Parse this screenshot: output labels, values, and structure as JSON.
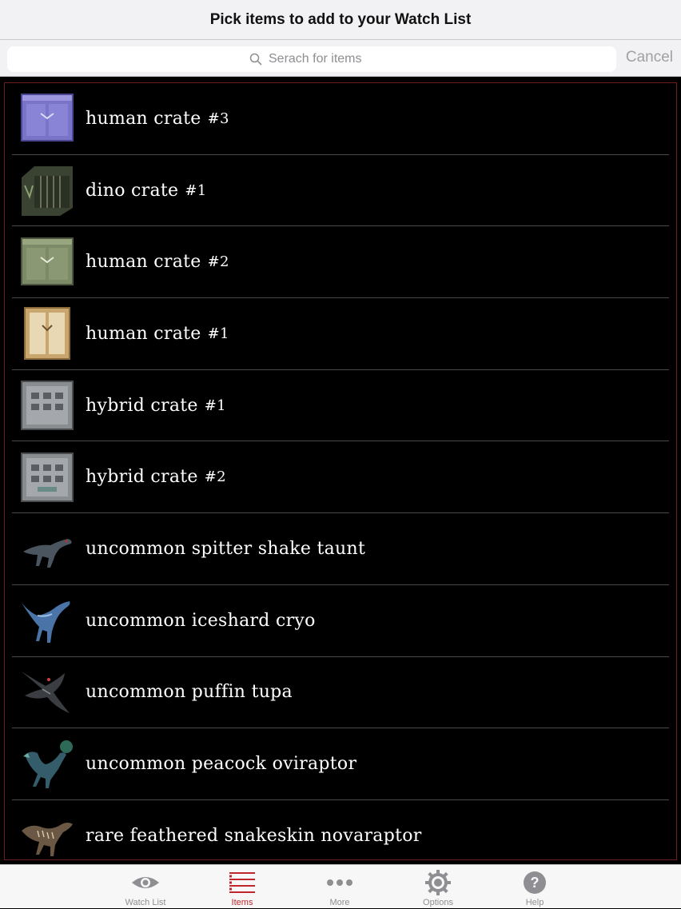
{
  "header": {
    "title": "Pick items to add to your Watch List"
  },
  "search": {
    "placeholder": "Serach for items",
    "cancel_label": "Cancel"
  },
  "items": [
    {
      "name": "human crate",
      "suffix": "#3",
      "icon": "crate-icon"
    },
    {
      "name": "dino crate",
      "suffix": "#1",
      "icon": "crate-icon"
    },
    {
      "name": "human crate",
      "suffix": "#2",
      "icon": "crate-icon"
    },
    {
      "name": "human crate",
      "suffix": "#1",
      "icon": "crate-icon"
    },
    {
      "name": "hybrid crate",
      "suffix": "#1",
      "icon": "crate-icon"
    },
    {
      "name": "hybrid crate",
      "suffix": "#2",
      "icon": "crate-icon"
    },
    {
      "name": "uncommon spitter shake taunt",
      "suffix": "",
      "icon": "dinosaur-icon"
    },
    {
      "name": "uncommon iceshard cryo",
      "suffix": "",
      "icon": "dinosaur-icon"
    },
    {
      "name": "uncommon puffin tupa",
      "suffix": "",
      "icon": "dinosaur-icon"
    },
    {
      "name": "uncommon peacock oviraptor",
      "suffix": "",
      "icon": "dinosaur-icon"
    },
    {
      "name": "rare feathered snakeskin novaraptor",
      "suffix": "",
      "icon": "dinosaur-icon"
    }
  ],
  "tabs": [
    {
      "label": "Watch List",
      "icon": "eye-icon"
    },
    {
      "label": "Items",
      "icon": "list-icon",
      "active": true
    },
    {
      "label": "More",
      "icon": "more-dots-icon"
    },
    {
      "label": "Options",
      "icon": "gear-icon"
    },
    {
      "label": "Help",
      "icon": "help-icon"
    }
  ],
  "colors": {
    "accent": "#c0272d",
    "list_background": "#000000",
    "list_border": "#6e1e1e"
  }
}
